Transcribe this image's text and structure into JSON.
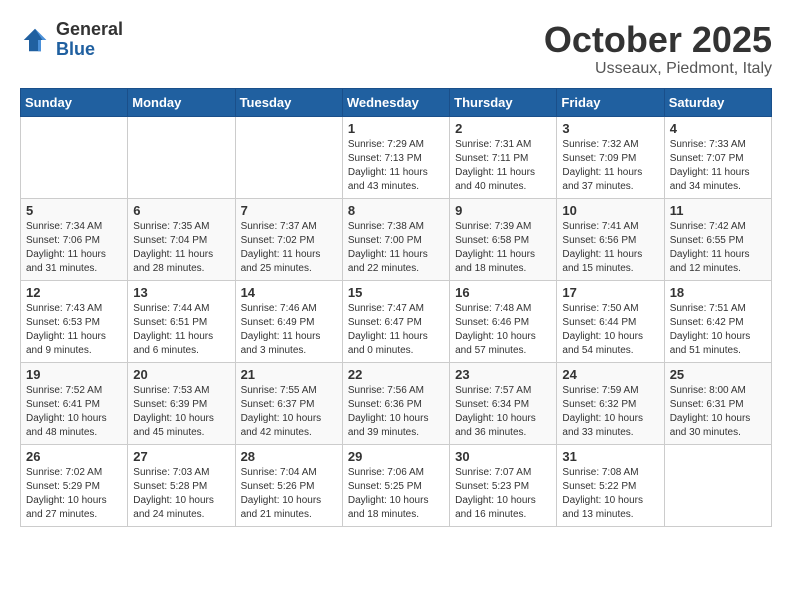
{
  "header": {
    "logo_general": "General",
    "logo_blue": "Blue",
    "month_title": "October 2025",
    "location": "Usseaux, Piedmont, Italy"
  },
  "weekdays": [
    "Sunday",
    "Monday",
    "Tuesday",
    "Wednesday",
    "Thursday",
    "Friday",
    "Saturday"
  ],
  "weeks": [
    [
      {
        "day": "",
        "info": ""
      },
      {
        "day": "",
        "info": ""
      },
      {
        "day": "",
        "info": ""
      },
      {
        "day": "1",
        "info": "Sunrise: 7:29 AM\nSunset: 7:13 PM\nDaylight: 11 hours\nand 43 minutes."
      },
      {
        "day": "2",
        "info": "Sunrise: 7:31 AM\nSunset: 7:11 PM\nDaylight: 11 hours\nand 40 minutes."
      },
      {
        "day": "3",
        "info": "Sunrise: 7:32 AM\nSunset: 7:09 PM\nDaylight: 11 hours\nand 37 minutes."
      },
      {
        "day": "4",
        "info": "Sunrise: 7:33 AM\nSunset: 7:07 PM\nDaylight: 11 hours\nand 34 minutes."
      }
    ],
    [
      {
        "day": "5",
        "info": "Sunrise: 7:34 AM\nSunset: 7:06 PM\nDaylight: 11 hours\nand 31 minutes."
      },
      {
        "day": "6",
        "info": "Sunrise: 7:35 AM\nSunset: 7:04 PM\nDaylight: 11 hours\nand 28 minutes."
      },
      {
        "day": "7",
        "info": "Sunrise: 7:37 AM\nSunset: 7:02 PM\nDaylight: 11 hours\nand 25 minutes."
      },
      {
        "day": "8",
        "info": "Sunrise: 7:38 AM\nSunset: 7:00 PM\nDaylight: 11 hours\nand 22 minutes."
      },
      {
        "day": "9",
        "info": "Sunrise: 7:39 AM\nSunset: 6:58 PM\nDaylight: 11 hours\nand 18 minutes."
      },
      {
        "day": "10",
        "info": "Sunrise: 7:41 AM\nSunset: 6:56 PM\nDaylight: 11 hours\nand 15 minutes."
      },
      {
        "day": "11",
        "info": "Sunrise: 7:42 AM\nSunset: 6:55 PM\nDaylight: 11 hours\nand 12 minutes."
      }
    ],
    [
      {
        "day": "12",
        "info": "Sunrise: 7:43 AM\nSunset: 6:53 PM\nDaylight: 11 hours\nand 9 minutes."
      },
      {
        "day": "13",
        "info": "Sunrise: 7:44 AM\nSunset: 6:51 PM\nDaylight: 11 hours\nand 6 minutes."
      },
      {
        "day": "14",
        "info": "Sunrise: 7:46 AM\nSunset: 6:49 PM\nDaylight: 11 hours\nand 3 minutes."
      },
      {
        "day": "15",
        "info": "Sunrise: 7:47 AM\nSunset: 6:47 PM\nDaylight: 11 hours\nand 0 minutes."
      },
      {
        "day": "16",
        "info": "Sunrise: 7:48 AM\nSunset: 6:46 PM\nDaylight: 10 hours\nand 57 minutes."
      },
      {
        "day": "17",
        "info": "Sunrise: 7:50 AM\nSunset: 6:44 PM\nDaylight: 10 hours\nand 54 minutes."
      },
      {
        "day": "18",
        "info": "Sunrise: 7:51 AM\nSunset: 6:42 PM\nDaylight: 10 hours\nand 51 minutes."
      }
    ],
    [
      {
        "day": "19",
        "info": "Sunrise: 7:52 AM\nSunset: 6:41 PM\nDaylight: 10 hours\nand 48 minutes."
      },
      {
        "day": "20",
        "info": "Sunrise: 7:53 AM\nSunset: 6:39 PM\nDaylight: 10 hours\nand 45 minutes."
      },
      {
        "day": "21",
        "info": "Sunrise: 7:55 AM\nSunset: 6:37 PM\nDaylight: 10 hours\nand 42 minutes."
      },
      {
        "day": "22",
        "info": "Sunrise: 7:56 AM\nSunset: 6:36 PM\nDaylight: 10 hours\nand 39 minutes."
      },
      {
        "day": "23",
        "info": "Sunrise: 7:57 AM\nSunset: 6:34 PM\nDaylight: 10 hours\nand 36 minutes."
      },
      {
        "day": "24",
        "info": "Sunrise: 7:59 AM\nSunset: 6:32 PM\nDaylight: 10 hours\nand 33 minutes."
      },
      {
        "day": "25",
        "info": "Sunrise: 8:00 AM\nSunset: 6:31 PM\nDaylight: 10 hours\nand 30 minutes."
      }
    ],
    [
      {
        "day": "26",
        "info": "Sunrise: 7:02 AM\nSunset: 5:29 PM\nDaylight: 10 hours\nand 27 minutes."
      },
      {
        "day": "27",
        "info": "Sunrise: 7:03 AM\nSunset: 5:28 PM\nDaylight: 10 hours\nand 24 minutes."
      },
      {
        "day": "28",
        "info": "Sunrise: 7:04 AM\nSunset: 5:26 PM\nDaylight: 10 hours\nand 21 minutes."
      },
      {
        "day": "29",
        "info": "Sunrise: 7:06 AM\nSunset: 5:25 PM\nDaylight: 10 hours\nand 18 minutes."
      },
      {
        "day": "30",
        "info": "Sunrise: 7:07 AM\nSunset: 5:23 PM\nDaylight: 10 hours\nand 16 minutes."
      },
      {
        "day": "31",
        "info": "Sunrise: 7:08 AM\nSunset: 5:22 PM\nDaylight: 10 hours\nand 13 minutes."
      },
      {
        "day": "",
        "info": ""
      }
    ]
  ]
}
